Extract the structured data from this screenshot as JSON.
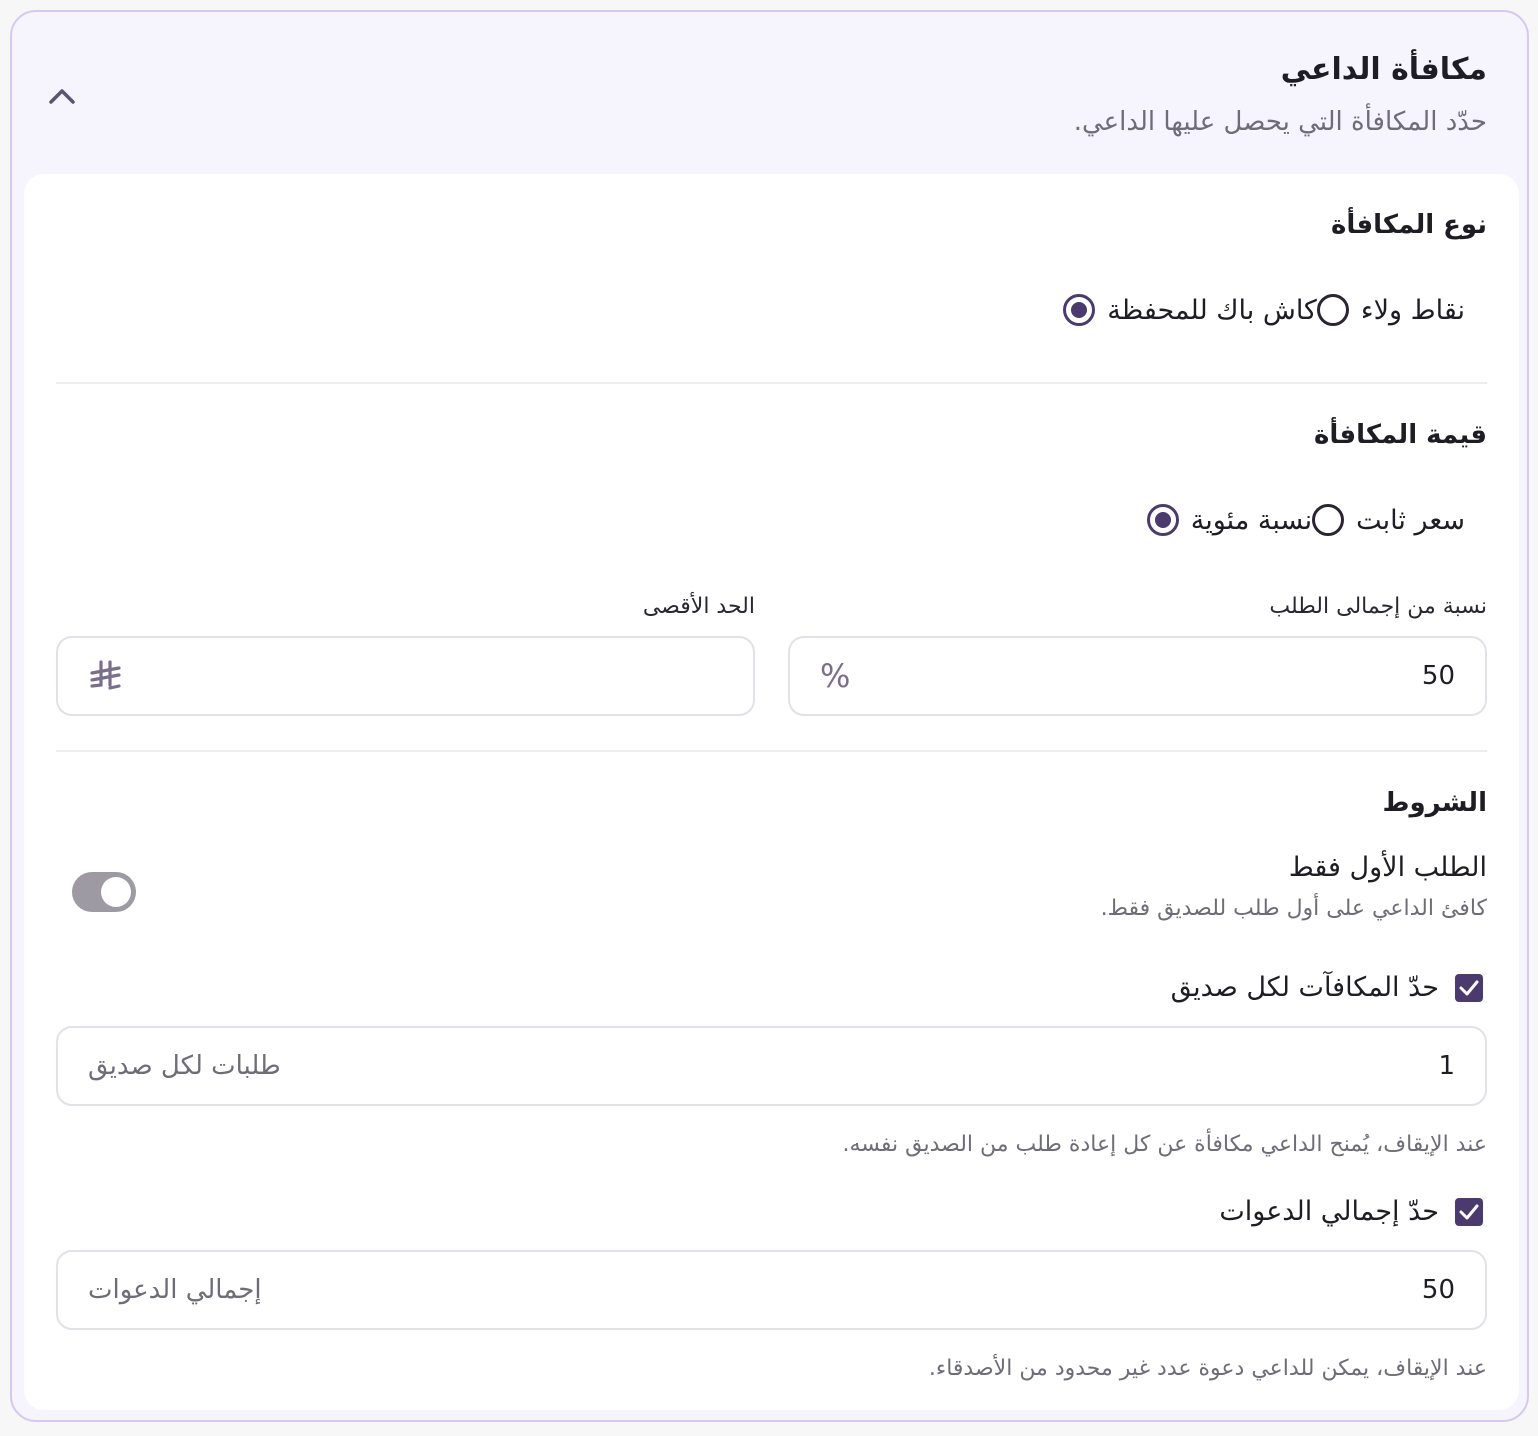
{
  "header": {
    "title": "مكافأة الداعي",
    "subtitle": "حدّد المكافأة التي يحصل عليها الداعي."
  },
  "reward_type": {
    "title": "نوع المكافأة",
    "options": [
      {
        "label": "كاش باك للمحفظة",
        "checked": true
      },
      {
        "label": "نقاط ولاء",
        "checked": false
      }
    ]
  },
  "reward_value": {
    "title": "قيمة المكافأة",
    "options": [
      {
        "label": "نسبة مئوية",
        "checked": true
      },
      {
        "label": "سعر ثابت",
        "checked": false
      }
    ],
    "percent_field": {
      "label": "نسبة من إجمالى الطلب",
      "value": "50",
      "suffix": "%"
    },
    "max_field": {
      "label": "الحد الأقصى",
      "value": "",
      "suffix": "⃁"
    }
  },
  "conditions": {
    "title": "الشروط",
    "first_order": {
      "title": "الطلب الأول فقط",
      "description": "كافئ الداعي على أول طلب للصديق فقط.",
      "enabled": true
    },
    "limit_per_friend": {
      "label": "حدّ المكافآت لكل صديق",
      "checked": true,
      "value": "1",
      "placeholder": "طلبات لكل صديق",
      "hint": "عند الإيقاف، يُمنح الداعي مكافأة عن كل إعادة طلب من الصديق نفسه."
    },
    "limit_total": {
      "label": "حدّ إجمالي الدعوات",
      "checked": true,
      "value": "50",
      "placeholder": "إجمالي الدعوات",
      "hint": "عند الإيقاف، يمكن للداعي دعوة عدد غير محدود من الأصدقاء."
    }
  },
  "colors": {
    "accent": "#4a3a6e",
    "panel_bg": "#f6f4fd",
    "panel_border": "#d6c8f0"
  }
}
